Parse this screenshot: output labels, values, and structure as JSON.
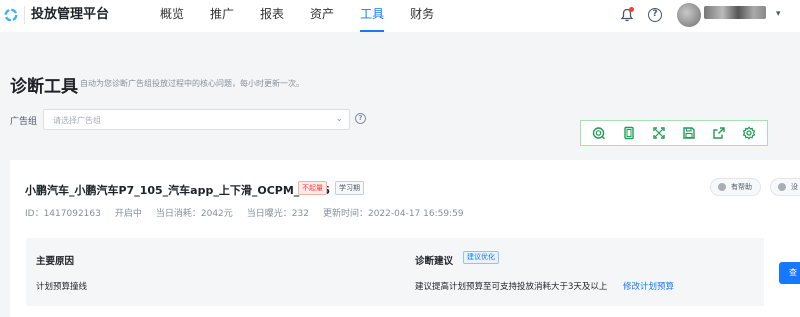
{
  "app": {
    "title": "投放管理平台"
  },
  "nav": {
    "items": [
      {
        "label": "概览"
      },
      {
        "label": "推广"
      },
      {
        "label": "报表"
      },
      {
        "label": "资产"
      },
      {
        "label": "工具",
        "active": true
      },
      {
        "label": "财务"
      }
    ]
  },
  "header_icons": [
    "bell-icon",
    "help-icon",
    "avatar",
    "chevron-down-icon"
  ],
  "page": {
    "title": "诊断工具",
    "description": "自动为您诊断广告组投放过程中的核心问题，每小时更新一次。"
  },
  "filter": {
    "label": "广告组",
    "placeholder": "请选择广告组",
    "info_icon": "?"
  },
  "toolbar": {
    "icons": [
      "screenshot-icon",
      "copy-icon",
      "expand-icon",
      "save-icon",
      "share-icon",
      "settings-icon"
    ]
  },
  "plan": {
    "name": "小鹏汽车_小鹏汽车P7_105_汽车app_上下滑_OCPM_0416",
    "tag_status": "不起量",
    "tag_phase": "学习期",
    "meta": {
      "id": "ID：1417092163",
      "status": "开启中",
      "today_spend": "当日消耗：2042元",
      "today_impressions": "当日曝光：232",
      "updated": "更新时间：2022-04-17 16:59:59"
    },
    "feedback": {
      "helpful": "有帮助",
      "useless": "没"
    }
  },
  "diagnosis": {
    "reason_title": "主要原因",
    "reason_text": "计划预算撞线",
    "suggestion_title": "诊断建议",
    "suggestion_tag": "建议优化",
    "suggestion_text": "建议提高计划预算至可支持投放消耗大于3天及以上",
    "suggestion_link": "修改计划预算",
    "side_button": "查"
  },
  "colors": {
    "accent": "#1677ff",
    "danger": "#f53f3f",
    "logo": "#3ab5f0",
    "toolbar_icon": "#1f9d55"
  }
}
